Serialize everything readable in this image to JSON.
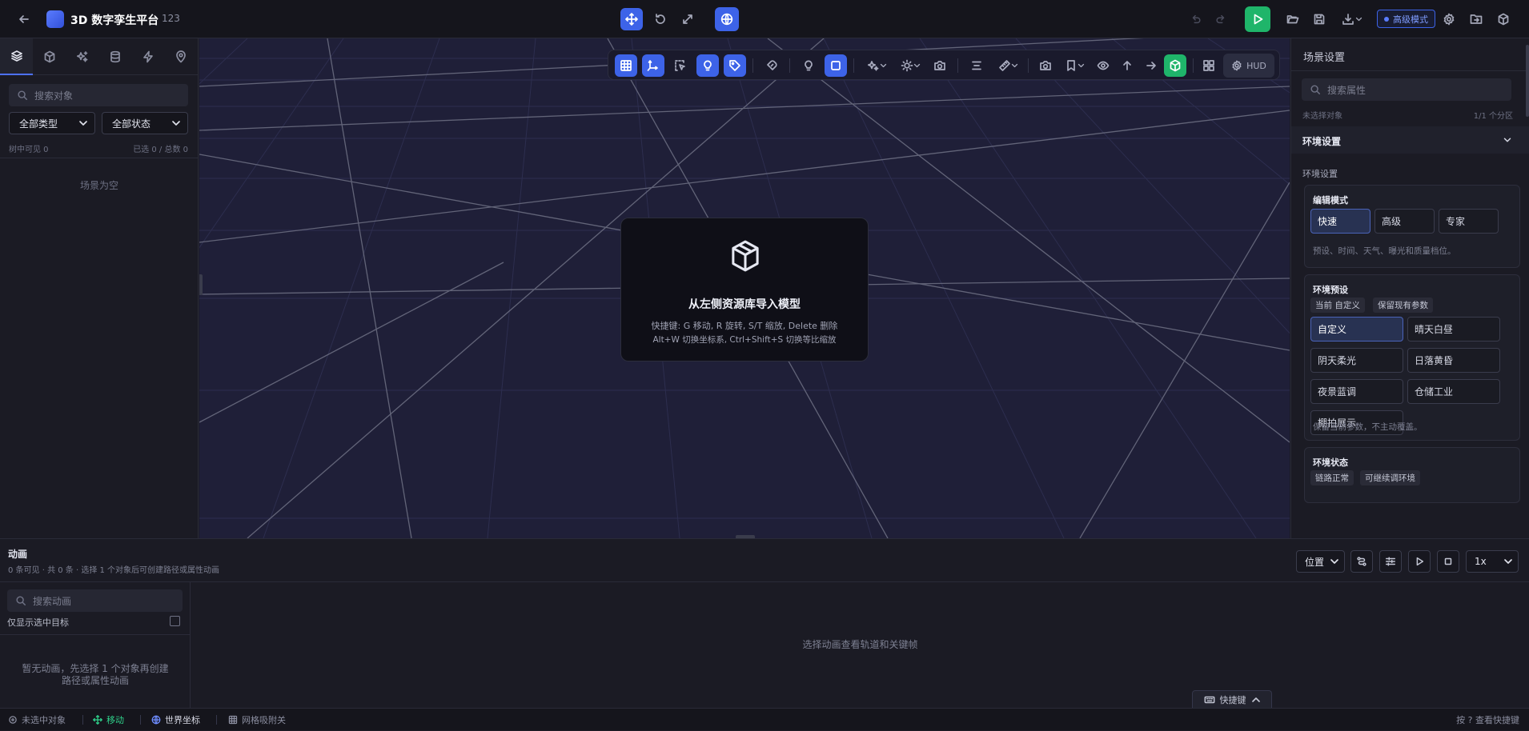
{
  "header": {
    "title": "3D 数字孪生平台",
    "subtitle": "123",
    "advanced_mode": "高级模式"
  },
  "left_panel": {
    "search_placeholder": "搜索对象",
    "type_filter": "全部类型",
    "state_filter": "全部状态",
    "visible_in_tree": "树中可见 0",
    "selected_total": "已选 0 / 总数 0",
    "empty_text": "场景为空"
  },
  "viewport": {
    "hud_label": "HUD",
    "empty_title": "从左侧资源库导入模型",
    "hint_line1": "快捷键: G 移动, R 旋转, S/T 缩放, Delete 删除",
    "hint_line2": "Alt+W 切换坐标系, Ctrl+Shift+S 切换等比缩放"
  },
  "right_panel": {
    "title": "场景设置",
    "search_placeholder": "搜索属性",
    "no_selection": "未选择对象",
    "partition_count": "1/1 个分区",
    "section_title": "环境设置",
    "sub_title": "环境设置",
    "edit_mode": {
      "title": "编辑模式",
      "options": [
        "快速",
        "高级",
        "专家"
      ],
      "selected": "快速",
      "note": "预设、时间、天气、曝光和质量档位。"
    },
    "env_preset": {
      "title": "环境预设",
      "chips": [
        "当前 自定义",
        "保留现有参数"
      ],
      "options": [
        "自定义",
        "晴天白昼",
        "阴天柔光",
        "日落黄昏",
        "夜景蓝调",
        "仓储工业",
        "棚拍展示"
      ],
      "selected": "自定义",
      "note": "保留当前参数，不主动覆盖。"
    },
    "env_status": {
      "title": "环境状态",
      "chips": [
        "链路正常",
        "可继续调环境"
      ]
    }
  },
  "animation": {
    "title": "动画",
    "summary": "0 条可见 · 共 0 条 · 选择 1 个对象后可创建路径或属性动画",
    "property_select": "位置",
    "speed_select": "1x",
    "search_placeholder": "搜索动画",
    "only_selected_label": "仅显示选中目标",
    "only_selected_checked": false,
    "empty_text": "暂无动画，先选择 1 个对象再创建路径或属性动画",
    "timeline_empty": "选择动画查看轨道和关键帧",
    "shortcut_button": "快捷键"
  },
  "status_bar": {
    "selection": "未选中对象",
    "tool": "移动",
    "coordinate": "世界坐标",
    "snap": "网格吸附关",
    "help": "按 ? 查看快捷键"
  },
  "colors": {
    "accent": "#3d63e8",
    "play_green": "#1fb56a",
    "viewport_bg": "#1f1f38",
    "status_green": "#2fd08a"
  }
}
